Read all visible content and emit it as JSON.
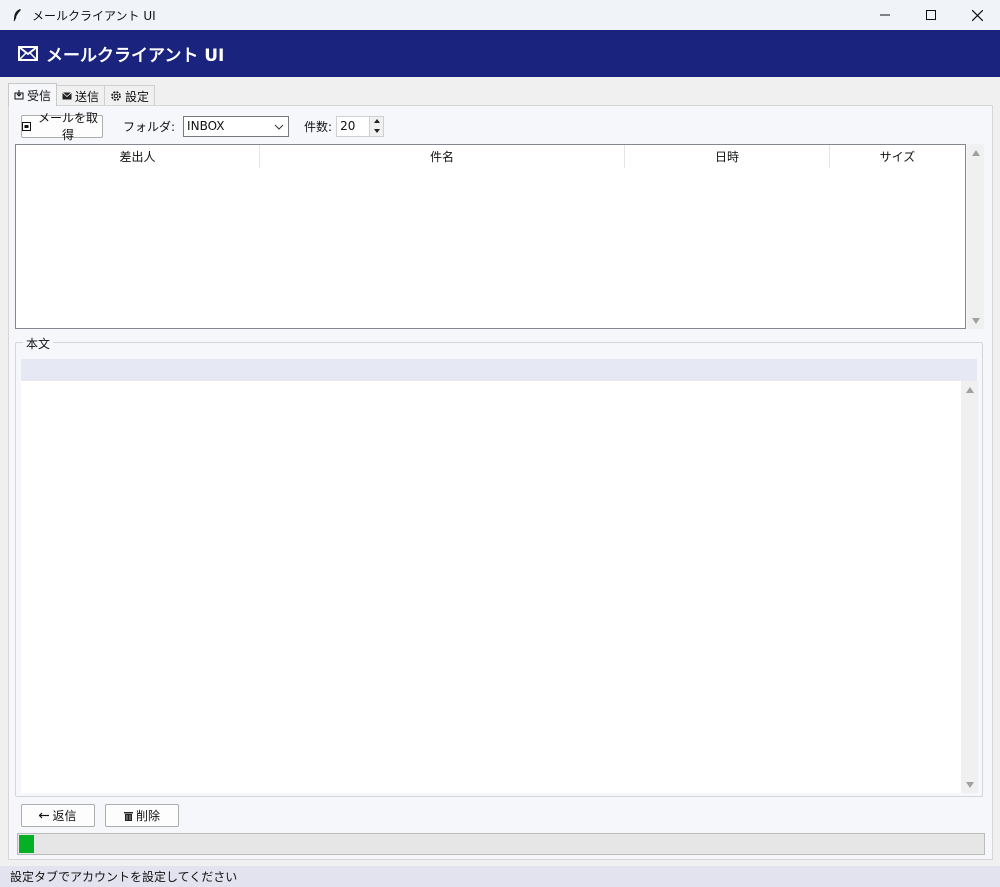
{
  "window": {
    "title": "メールクライアント UI"
  },
  "banner": {
    "title": "メールクライアント UI"
  },
  "tabs": [
    {
      "label": "受信",
      "icon": "inbox-tray-icon"
    },
    {
      "label": "送信",
      "icon": "envelope-icon"
    },
    {
      "label": "設定",
      "icon": "gear-icon"
    }
  ],
  "toolbar": {
    "fetch_label": "メールを取得",
    "folder_label": "フォルダ:",
    "folder_value": "INBOX",
    "count_label": "件数:",
    "count_value": "20"
  },
  "maillist": {
    "columns": [
      "差出人",
      "件名",
      "日時",
      "サイズ"
    ]
  },
  "body": {
    "legend": "本文"
  },
  "actions": {
    "reply_label": "返信",
    "delete_label": "削除"
  },
  "progress": {
    "value": 0.016
  },
  "status": {
    "text": "設定タブでアカウントを設定してください"
  },
  "colors": {
    "banner": "#1a237e",
    "progress_fill": "#06b025",
    "status_bar": "#e3e3ef"
  }
}
